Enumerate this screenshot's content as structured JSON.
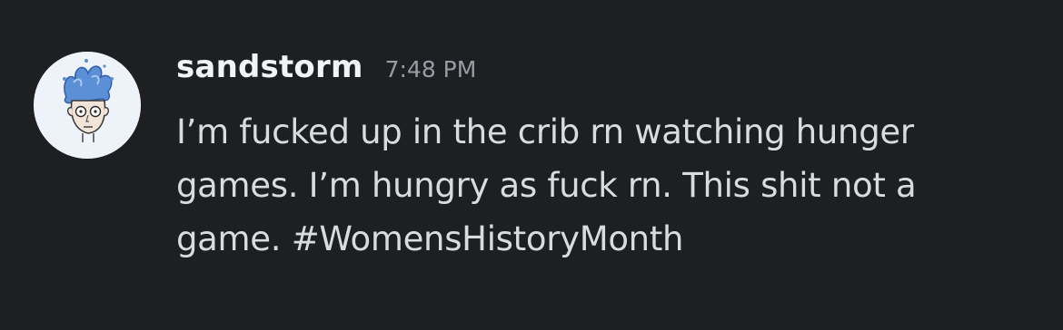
{
  "message": {
    "author": "sandstorm",
    "timestamp": "7:48 PM",
    "content_lines": [
      "I’m fucked up in the crib rn watching hunger",
      "games. I’m hungry as fuck rn. This shit not a",
      "game. #WomensHistoryMonth"
    ],
    "avatar_icon": "cartoon-face-avatar-icon"
  },
  "colors": {
    "background": "#1e1f23",
    "username": "#f2f3f5",
    "timestamp": "#9a9ca3",
    "message_text": "#dadbdf",
    "avatar_hair": "#5b8fd6"
  }
}
